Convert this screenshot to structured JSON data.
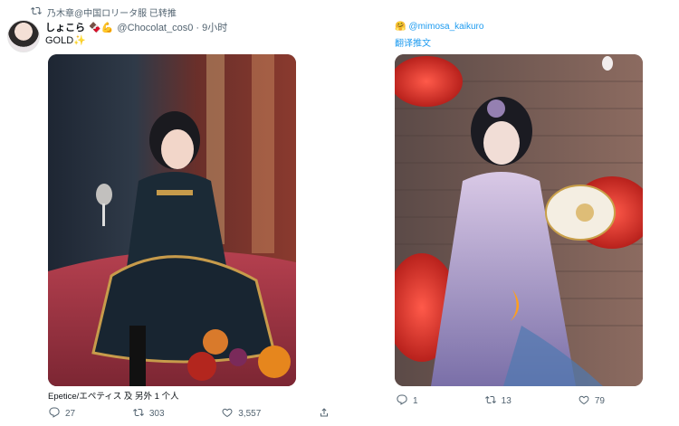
{
  "left_tweet": {
    "retweet_label": "乃木章@中国ロリータ服 已转推",
    "display_name": "しょこら",
    "name_emojis": "🍫💪",
    "handle_time": "@Chocolat_cos0 · 9小时",
    "text": "GOLD✨",
    "image_tags": "Epetice/エペティス 及 另外 1 个人",
    "actions": {
      "replies": "27",
      "retweets": "303",
      "likes": "3,557"
    }
  },
  "right_tweet": {
    "handle": "@mimosa_kaikuro",
    "handle_emoji": "🤗",
    "translate": "翻译推文",
    "actions": {
      "replies": "1",
      "retweets": "13",
      "likes": "79"
    }
  }
}
